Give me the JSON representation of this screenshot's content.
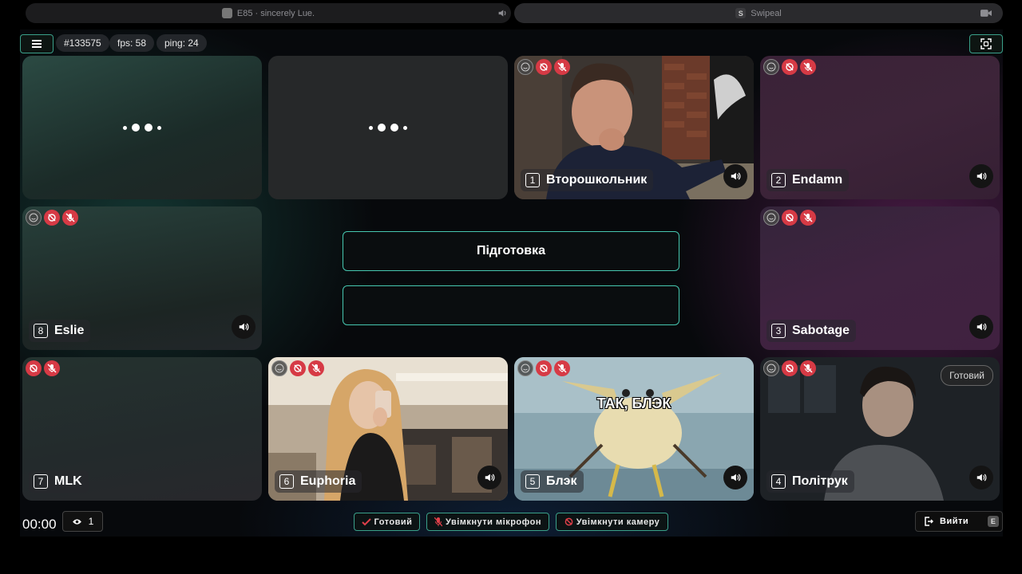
{
  "browser": {
    "tab1_title": "E85 · sincerely Lue.",
    "tab2_title": "Swipeal",
    "tab2_favicon": "S"
  },
  "header": {
    "room_id": "#133575",
    "fps": "fps: 58",
    "ping": "ping: 24"
  },
  "players": [
    {
      "num": "1",
      "name": "Второшкольник"
    },
    {
      "num": "2",
      "name": "Endamn"
    },
    {
      "num": "3",
      "name": "Sabotage"
    },
    {
      "num": "4",
      "name": "Політрук",
      "status": "Готовий"
    },
    {
      "num": "5",
      "name": "Блэк",
      "meme_caption": "ТАК, БЛЭК"
    },
    {
      "num": "6",
      "name": "Euphoria"
    },
    {
      "num": "7",
      "name": "MLK"
    },
    {
      "num": "8",
      "name": "Eslie"
    }
  ],
  "center": {
    "phase": "Підготовка"
  },
  "footer": {
    "timer": "00:00",
    "viewers": "1",
    "ready_label": "Готовий",
    "mic_label": "Увімкнути мікрофон",
    "camera_label": "Увімкнути камеру",
    "exit_label": "Вийти",
    "exit_key": "E"
  },
  "colors": {
    "accent": "#46c7b0",
    "mute_red": "#d63a45"
  }
}
